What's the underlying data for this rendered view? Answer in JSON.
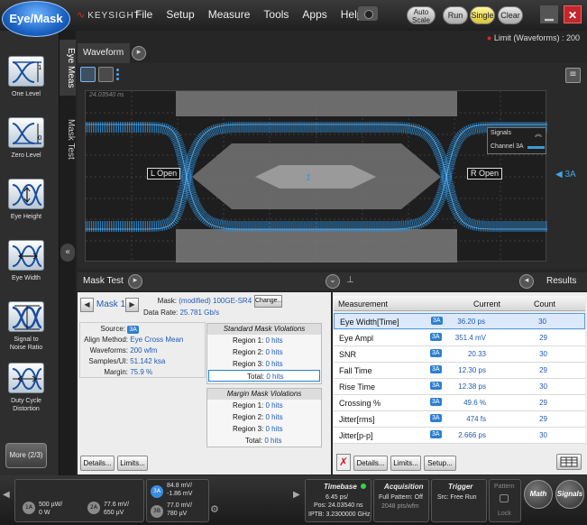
{
  "app": {
    "mode_button": "Eye/Mask",
    "brand": "KEYSIGHT",
    "menu": [
      "File",
      "Setup",
      "Measure",
      "Tools",
      "Apps",
      "Help"
    ],
    "buttons": {
      "auto_scale_1": "Auto",
      "auto_scale_2": "Scale",
      "run": "Run",
      "single": "Single",
      "clear": "Clear"
    },
    "limit_status": "Limit (Waveforms) : 200",
    "colors": {
      "accent": "#2d7fd0",
      "waveform": "#3a9bd6",
      "single": "#e8d64a",
      "close": "#c1272d"
    }
  },
  "left_tools": [
    {
      "label": "One Level",
      "icon": "one-level-icon"
    },
    {
      "label": "Zero Level",
      "icon": "zero-level-icon"
    },
    {
      "label": "Eye Height",
      "icon": "eye-height-icon"
    },
    {
      "label": "Eye Width",
      "icon": "eye-width-icon"
    },
    {
      "label": "Signal to Noise Ratio",
      "icon": "snr-icon"
    },
    {
      "label": "Duty Cycle Distortion",
      "icon": "dcd-icon"
    }
  ],
  "more_button": "More (2/3)",
  "vtabs": {
    "eye_meas": "Eye Meas",
    "mask_test": "Mask Test"
  },
  "waveform": {
    "tab": "Waveform",
    "time_label": "24.03540 ns",
    "signals_title": "Signals",
    "signals_channel": "Channel 3A",
    "l_open": "L Open",
    "r_open": "R Open",
    "center_label": "1",
    "channel_marker": "3A"
  },
  "mask_test": {
    "title": "Mask Test",
    "mask_name": "Mask 1",
    "mask_label": "Mask:",
    "mask_value": "(modified) 100GE-SR4",
    "change_button": "Change...",
    "data_rate_label": "Data Rate:",
    "data_rate_value": "25.781 Gb/s",
    "source_label": "Source:",
    "source_value": "3A",
    "align_label": "Align Method:",
    "align_value": "Eye Cross Mean",
    "waveforms_label": "Waveforms:",
    "waveforms_value": "200 wfm",
    "samples_label": "Samples/UI:",
    "samples_value": "51.142 ksa",
    "margin_label": "Margin:",
    "margin_value": "75.9 %",
    "standard_title": "Standard Mask Violations",
    "margin_title": "Margin Mask Violations",
    "standard_rows": [
      {
        "label": "Region 1:",
        "value": "0 hits"
      },
      {
        "label": "Region 2:",
        "value": "0 hits"
      },
      {
        "label": "Region 3:",
        "value": "0 hits"
      }
    ],
    "standard_total_label": "Total:",
    "standard_total_value": "0 hits",
    "margin_rows": [
      {
        "label": "Region 1:",
        "value": "0 hits"
      },
      {
        "label": "Region 2:",
        "value": "0 hits"
      },
      {
        "label": "Region 3:",
        "value": "0 hits"
      }
    ],
    "margin_total_label": "Total:",
    "margin_total_value": "0 hits",
    "details_button": "Details...",
    "limits_button": "Limits..."
  },
  "results": {
    "title": "Results",
    "headers": {
      "measurement": "Measurement",
      "current": "Current",
      "count": "Count"
    },
    "rows": [
      {
        "name": "Eye Width[Time]",
        "source": "3A",
        "current": "36.20 ps",
        "count": "30"
      },
      {
        "name": "Eye Ampl",
        "source": "3A",
        "current": "351.4 mV",
        "count": "29"
      },
      {
        "name": "SNR",
        "source": "3A",
        "current": "20.33",
        "count": "30"
      },
      {
        "name": "Fall Time",
        "source": "3A",
        "current": "12.30 ps",
        "count": "29"
      },
      {
        "name": "Rise Time",
        "source": "3A",
        "current": "12.38 ps",
        "count": "30"
      },
      {
        "name": "Crossing %",
        "source": "3A",
        "current": "49.6 %",
        "count": "29"
      },
      {
        "name": "Jitter[rms]",
        "source": "3A",
        "current": "474 fs",
        "count": "29"
      },
      {
        "name": "Jitter[p-p]",
        "source": "3A",
        "current": "2.666 ps",
        "count": "30"
      }
    ],
    "details_button": "Details...",
    "limits_button": "Limits...",
    "setup_button": "Setup..."
  },
  "status": {
    "ch1a": {
      "id": "1A",
      "scale": "500 µW/",
      "offset": "0 W"
    },
    "ch2a": {
      "id": "2A",
      "scale": "77.6 mV/",
      "offset": "650 µV"
    },
    "ch3a": {
      "id": "3A",
      "scale": "84.8 mV/",
      "offset": "-1.86 mV"
    },
    "ch3b": {
      "id": "3B",
      "scale": "77.0 mV/",
      "offset": "780 µV"
    },
    "timebase": {
      "title": "Timebase",
      "scale": "6.45 ps/",
      "pos": "Pos: 24.03540 ns",
      "iptb": "IPTB: 3.2300000 GHz"
    },
    "acquisition": {
      "title": "Acquisition",
      "line1": "Full Pattern: Off",
      "line2": "2048 pts/wfm"
    },
    "trigger": {
      "title": "Trigger",
      "line1": "Src: Free Run"
    },
    "pattern": {
      "title": "Pattern",
      "lock": "Lock"
    },
    "math": "Math",
    "signals": "Signals"
  }
}
